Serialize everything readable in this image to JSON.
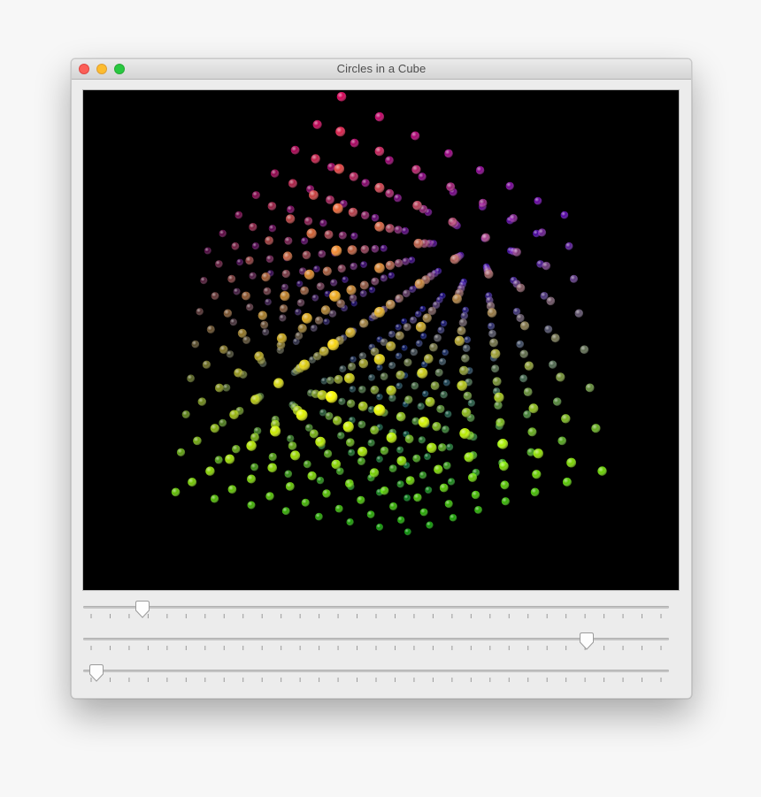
{
  "window": {
    "title": "Circles in a Cube",
    "controls": [
      "close",
      "minimize",
      "zoom"
    ]
  },
  "scene": {
    "background": "#000000",
    "grid_size": 8,
    "color_axes": {
      "x": "red",
      "y": "green",
      "z": "blue"
    }
  },
  "sliders": [
    {
      "value": 0.09,
      "tick_count": 31
    },
    {
      "value": 0.87,
      "tick_count": 31
    },
    {
      "value": 0.01,
      "tick_count": 31
    }
  ],
  "colors": {
    "window_bg": "#ececec",
    "track": "#c4c4c4",
    "tick": "#9a9a9a",
    "close": "#fc5f57",
    "minimize": "#fdbc2e",
    "zoom": "#28c840"
  }
}
